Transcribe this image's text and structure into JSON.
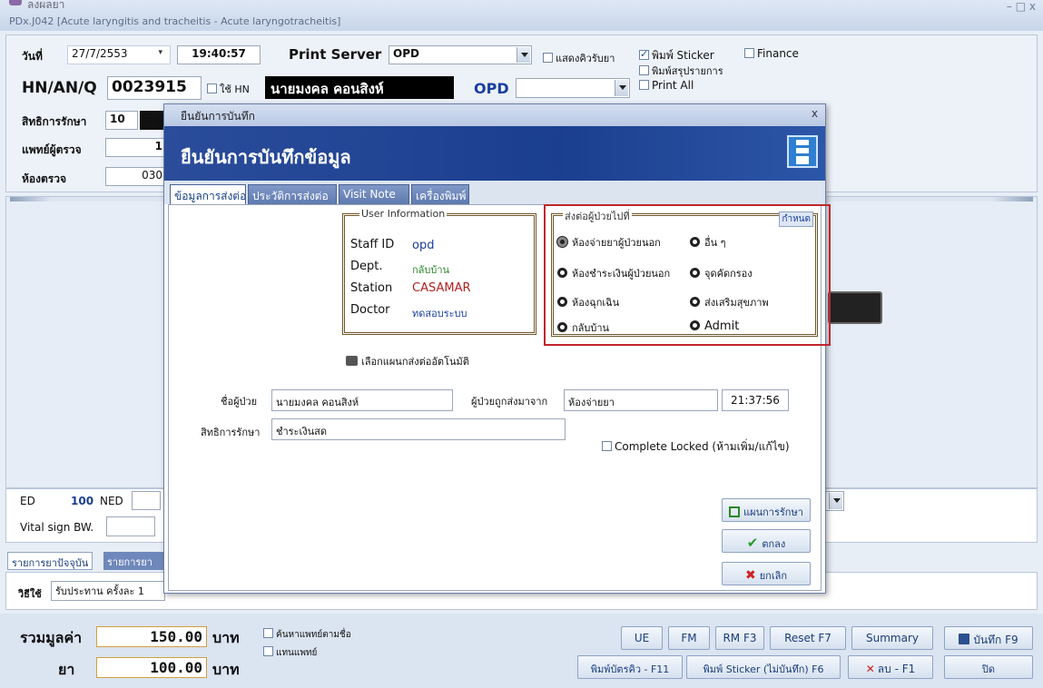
{
  "window": {
    "title": "ลงผลยา",
    "subtitle": "PDx.J042 [Acute laryngitis and tracheitis - Acute laryngotracheitis]",
    "controls": "– □ x"
  },
  "header": {
    "date_label": "วันที่",
    "date_value": "27/7/2553",
    "time_value": "19:40:57",
    "print_server_label": "Print Server",
    "print_server_value": "OPD",
    "show_queue": "แสดงคิวรับยา",
    "print_sticker": "พิมพ์ Sticker",
    "finance": "Finance",
    "print_summary": "พิมพ์สรุปรายการ",
    "print_all": "Print All",
    "hn_label": "HN/AN/Q",
    "hn_value": "0023915",
    "use_hn": "ใช้ HN",
    "patient_name": "นายมงคล คอนสิงห์",
    "opd_label": "OPD",
    "rights_label": "สิทธิการรักษา",
    "rights_value": "10",
    "doctor_label": "แพทย์ผู้ตรวจ",
    "doctor_value": "1",
    "room_label": "ห้องตรวจ",
    "room_value": "030"
  },
  "background": {
    "ed_label": "ED",
    "ed_value": "100",
    "ned_label": "NED",
    "vital_label": "Vital sign  BW.",
    "tab_current": "รายการยาปัจจุบัน",
    "tab_drug": "รายการยา",
    "usage_label": "วิธีใช้",
    "usage_value": "รับประทาน ครั้งละ  1"
  },
  "footer": {
    "total_label": "รวมมูลค่า",
    "total_value": "150.00",
    "baht1": "บาท",
    "drug_label": "ยา",
    "drug_value": "100.00",
    "baht2": "บาท",
    "search_doctor": "ค้นหาแพทย์ตามชื่อ",
    "substitute_doctor": "แทนแพทย์",
    "ue": "UE",
    "fm": "FM",
    "rm": "RM F3",
    "reset": "Reset F7",
    "summary": "Summary",
    "save": "บันทึก F9",
    "print_queue": "พิมพ์บัตรคิว - F11",
    "print_sticker_nosave": "พิมพ์ Sticker (ไม่บันทึก) F6",
    "delete": "ลบ - F1",
    "close": "ปิด"
  },
  "dialog": {
    "title": "ยืนยันการบันทึก",
    "heading": "ยืนยันการบันทึกข้อมูล",
    "close": "x",
    "tabs": [
      "ข้อมูลการส่งต่อ",
      "ประวัติการส่งต่อ",
      "Visit Note",
      "เครื่องพิมพ์"
    ],
    "user_info": {
      "legend": "User Information",
      "staff_label": "Staff ID",
      "staff_value": "opd",
      "dept_label": "Dept.",
      "dept_value": "กลับบ้าน",
      "station_label": "Station",
      "station_value": "CASAMAR",
      "doctor_label": "Doctor",
      "doctor_value": "ทดสอบระบบ"
    },
    "forward": {
      "legend": "ส่งต่อผู้ป่วยไปที่",
      "define": "กำหนด",
      "options": [
        "ห้องจ่ายยาผู้ป่วยนอก",
        "อื่น ๆ",
        "ห้องชำระเงินผู้ป่วยนอก",
        "จุดคัดกรอง",
        "ห้องฉุกเฉิน",
        "ส่งเสริมสุขภาพ",
        "กลับบ้าน",
        "Admit"
      ],
      "selected": "ห้องจ่ายยาผู้ป่วยนอก"
    },
    "auto_plan": "เลือกแผนกส่งต่ออัตโนมัติ",
    "patient_label": "ชื่อผู้ป่วย",
    "patient_value": "นายมงคล คอนสิงห์",
    "from_label": "ผู้ป่วยถูกส่งมาจาก",
    "from_value": "ห้องจ่ายยา",
    "time_value": "21:37:56",
    "rights_label": "สิทธิการรักษา",
    "rights_value": "ชำระเงินสด",
    "complete_locked": "Complete Locked (ห้ามเพิ่ม/แก้ไข)",
    "plan_button": "แผนการรักษา",
    "ok_button": "ตกลง",
    "cancel_button": "ยกเลิก"
  },
  "colors": {
    "accent": "#1a4fa0",
    "dialog_header": "#1b3f8f",
    "highlight_box": "#c0262c"
  }
}
